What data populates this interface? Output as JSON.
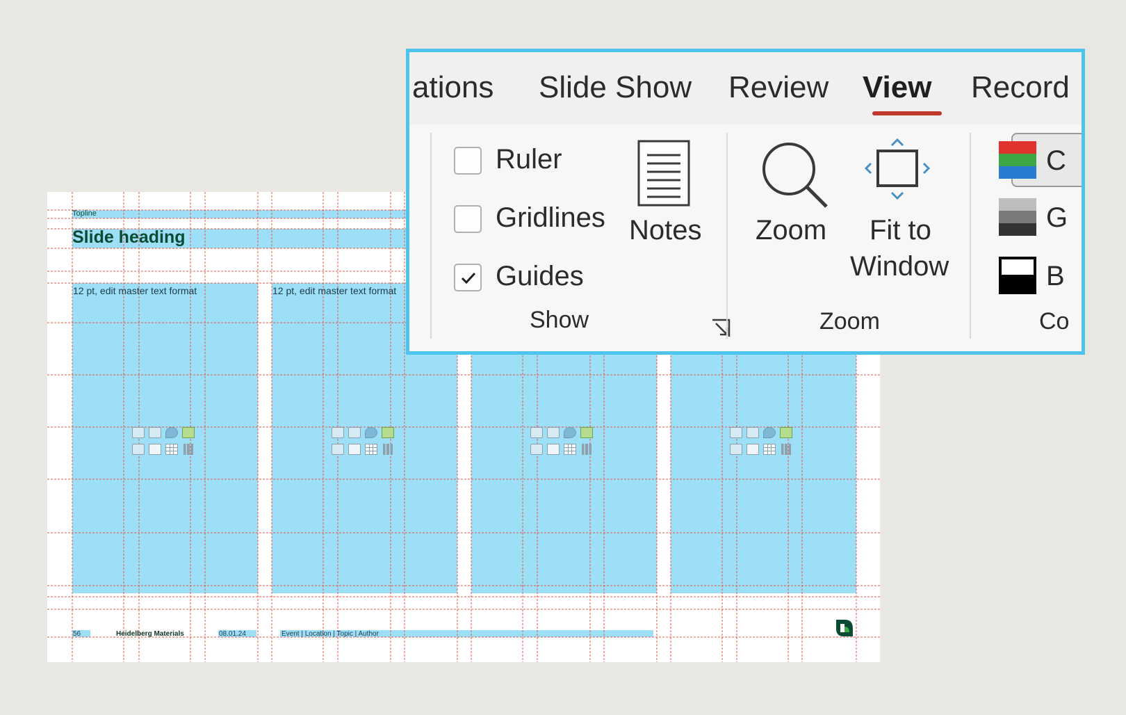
{
  "slide": {
    "topline": "Topline",
    "heading": "Slide heading",
    "columns": [
      {
        "label": "12 pt, edit master text format"
      },
      {
        "label": "12 pt, edit master text format"
      },
      {
        "label": ""
      },
      {
        "label": ""
      }
    ],
    "footer": {
      "page_number": "56",
      "company": "Heidelberg Materials",
      "date": "08.01.24",
      "event": "Event | Location | Topic | Author"
    }
  },
  "ribbon": {
    "tabs": [
      {
        "label": "ations"
      },
      {
        "label": "Slide Show"
      },
      {
        "label": "Review"
      },
      {
        "label": "View",
        "active": true
      },
      {
        "label": "Record"
      }
    ],
    "show_group": {
      "checkboxes": [
        {
          "label": "Ruler",
          "checked": false
        },
        {
          "label": "Gridlines",
          "checked": false
        },
        {
          "label": "Guides",
          "checked": true
        }
      ],
      "notes_label": "Notes",
      "group_label": "Show"
    },
    "zoom_group": {
      "zoom_label": "Zoom",
      "fit_label_1": "Fit to",
      "fit_label_2": "Window",
      "group_label": "Zoom"
    },
    "color_group": {
      "color_label": "C",
      "grayscale_label": "G",
      "bw_label": "B",
      "group_label": "Co"
    }
  },
  "colors": {
    "accent_tab": "#c0392b",
    "panel_border": "#4cc4ee",
    "placeholder": "#9edff8",
    "guide": "#e05a4a",
    "brand_green": "#0b4a33"
  }
}
